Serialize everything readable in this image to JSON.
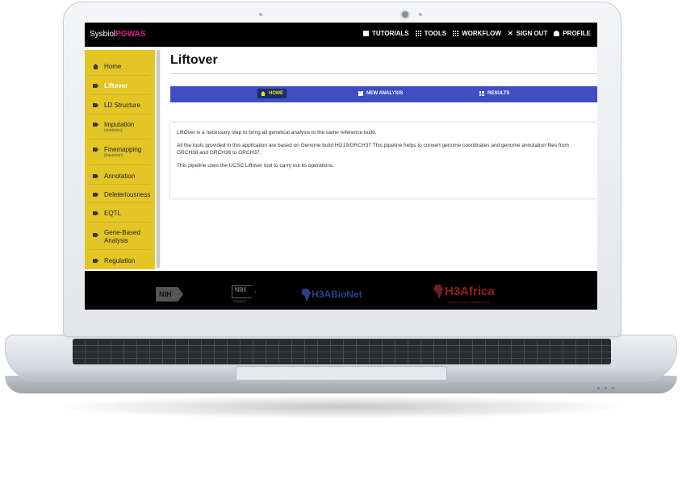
{
  "app": {
    "brand_prefix": "Sysbiol",
    "brand_suffix": "PGWAS",
    "brand_accent_color": "#e0188c"
  },
  "topnav": [
    {
      "label": "TUTORIALS",
      "icon": "book-icon"
    },
    {
      "label": "TOOLS",
      "icon": "grid-icon"
    },
    {
      "label": "WORKFLOW",
      "icon": "workflow-icon"
    },
    {
      "label": "SIGN OUT",
      "icon": "close-icon"
    },
    {
      "label": "PROFILE",
      "icon": "user-icon"
    }
  ],
  "sidebar": {
    "items": [
      {
        "label": "Home",
        "sub": "",
        "icon": "home-icon",
        "active": false
      },
      {
        "label": "Liftover",
        "sub": "",
        "icon": "tag-icon",
        "active": true
      },
      {
        "label": "LD Structure",
        "sub": "",
        "icon": "tag-icon",
        "active": false
      },
      {
        "label": "Imputation",
        "sub": "(statistics)",
        "icon": "tag-icon",
        "active": false
      },
      {
        "label": "Finemapping",
        "sub": "(bayesian)",
        "icon": "tag-icon",
        "active": false
      },
      {
        "label": "Annotation",
        "sub": "",
        "icon": "tag-icon",
        "active": false
      },
      {
        "label": "Deleteriousness",
        "sub": "",
        "icon": "tag-icon",
        "active": false
      },
      {
        "label": "EQTL",
        "sub": "",
        "icon": "tag-icon",
        "active": false
      },
      {
        "label": "Gene-Based",
        "sub": "Analysis",
        "icon": "tag-icon",
        "active": false
      },
      {
        "label": "Regulation",
        "sub": "",
        "icon": "tag-icon",
        "active": false
      }
    ],
    "bg_color": "#e3c526"
  },
  "page": {
    "title": "Liftover"
  },
  "tabs": [
    {
      "label": "HOME",
      "icon": "home-icon",
      "active": true
    },
    {
      "label": "NEW ANALYSIS",
      "icon": "add-icon",
      "active": false
    },
    {
      "label": "RESULTS",
      "icon": "table-icon",
      "active": false
    }
  ],
  "content": {
    "p1": "LiftOver is a necessary step to bring all genetical analysis to the same reference build.",
    "p2": "All the tools provided in this application are based on Genome build HG19/GRCH37 This pipeline helps to convert genome coordinates and genome annotation files from GRCH38 and GRCH36 to GRCH37.",
    "p3": "This pipeline uses the UCSC Liftover tool to carry out its operations."
  },
  "footer": {
    "logo1": "NIH",
    "logo2": "NIH",
    "logo2_sub": "FOGARTY",
    "logo3": "H3ABioNet",
    "logo4": "H3Africa",
    "logo4_sub": "Human Heredity & Health in Africa"
  },
  "colors": {
    "tabbar": "#3d4fc3",
    "active_tab_text": "#f2e600"
  }
}
